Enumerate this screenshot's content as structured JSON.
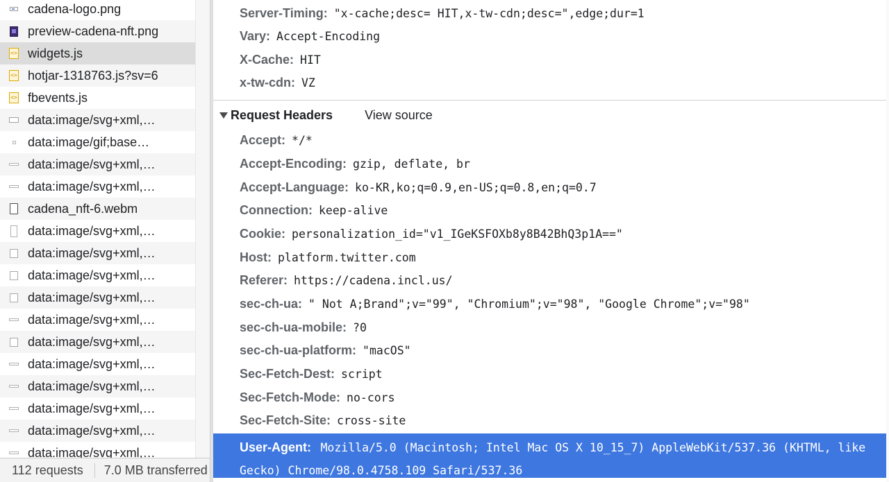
{
  "request_list": [
    {
      "icon": "image-file-icon",
      "name": "cadena-logo.png"
    },
    {
      "icon": "image-file-icon",
      "name": "preview-cadena-nft.png"
    },
    {
      "icon": "script-file-icon",
      "name": "widgets.js",
      "selected": true
    },
    {
      "icon": "script-file-icon",
      "name": "hotjar-1318763.js?sv=6"
    },
    {
      "icon": "script-file-icon",
      "name": "fbevents.js"
    },
    {
      "icon": "svg-file-icon",
      "name": "data:image/svg+xml,…"
    },
    {
      "icon": "gif-file-icon",
      "name": "data:image/gif;base…"
    },
    {
      "icon": "svg-file-icon",
      "name": "data:image/svg+xml,…"
    },
    {
      "icon": "svg-file-icon",
      "name": "data:image/svg+xml,…"
    },
    {
      "icon": "media-file-icon",
      "name": "cadena_nft-6.webm"
    },
    {
      "icon": "svg-file-icon",
      "name": "data:image/svg+xml,…"
    },
    {
      "icon": "svg-file-icon",
      "name": "data:image/svg+xml,…"
    },
    {
      "icon": "svg-file-icon",
      "name": "data:image/svg+xml,…"
    },
    {
      "icon": "svg-file-icon",
      "name": "data:image/svg+xml,…"
    },
    {
      "icon": "svg-file-icon",
      "name": "data:image/svg+xml,…"
    },
    {
      "icon": "svg-file-icon",
      "name": "data:image/svg+xml,…"
    },
    {
      "icon": "svg-file-icon",
      "name": "data:image/svg+xml,…"
    },
    {
      "icon": "svg-file-icon",
      "name": "data:image/svg+xml,…"
    },
    {
      "icon": "svg-file-icon",
      "name": "data:image/svg+xml,…"
    },
    {
      "icon": "svg-file-icon",
      "name": "data:image/svg+xml,…"
    },
    {
      "icon": "svg-file-icon",
      "name": "data:image/svg+xml,…"
    }
  ],
  "status_bar": {
    "requests": "112 requests",
    "transferred": "7.0 MB transferred"
  },
  "response_headers": [
    {
      "name": "Server-Timing:",
      "value": "\"x-cache;desc= HIT,x-tw-cdn;desc=\",edge;dur=1"
    },
    {
      "name": "Vary:",
      "value": "Accept-Encoding"
    },
    {
      "name": "X-Cache:",
      "value": "HIT"
    },
    {
      "name": "x-tw-cdn:",
      "value": "VZ"
    }
  ],
  "request_section": {
    "title": "Request Headers",
    "view_source": "View source"
  },
  "request_headers": [
    {
      "name": "Accept:",
      "value": "*/*"
    },
    {
      "name": "Accept-Encoding:",
      "value": "gzip, deflate, br"
    },
    {
      "name": "Accept-Language:",
      "value": "ko-KR,ko;q=0.9,en-US;q=0.8,en;q=0.7"
    },
    {
      "name": "Connection:",
      "value": "keep-alive"
    },
    {
      "name": "Cookie:",
      "value": "personalization_id=\"v1_IGeKSFOXb8y8B42BhQ3p1A==\""
    },
    {
      "name": "Host:",
      "value": "platform.twitter.com"
    },
    {
      "name": "Referer:",
      "value": "https://cadena.incl.us/"
    },
    {
      "name": "sec-ch-ua:",
      "value": "\" Not A;Brand\";v=\"99\", \"Chromium\";v=\"98\", \"Google Chrome\";v=\"98\""
    },
    {
      "name": "sec-ch-ua-mobile:",
      "value": "?0"
    },
    {
      "name": "sec-ch-ua-platform:",
      "value": "\"macOS\""
    },
    {
      "name": "Sec-Fetch-Dest:",
      "value": "script"
    },
    {
      "name": "Sec-Fetch-Mode:",
      "value": "no-cors"
    },
    {
      "name": "Sec-Fetch-Site:",
      "value": "cross-site"
    }
  ],
  "user_agent": {
    "name": "User-Agent:",
    "line1": "Mozilla/5.0 (Macintosh; Intel Mac OS X 10_15_7) AppleWebKit/537.36 (KHTML, like",
    "line2": "Gecko) Chrome/98.0.4758.109 Safari/537.36"
  },
  "colors": {
    "selection_blue": "#3e77e0",
    "header_name_gray": "#5f6368",
    "selected_row": "#dcdcdc"
  }
}
